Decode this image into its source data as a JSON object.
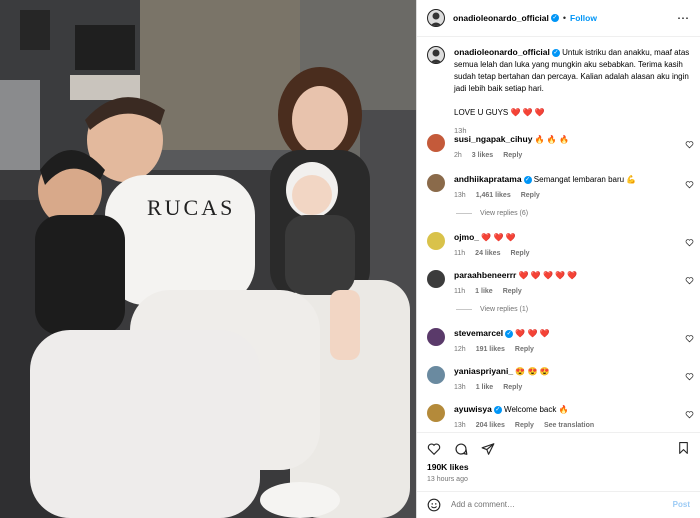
{
  "post": {
    "author": "onadioleonardo_official",
    "follow_label": "Follow",
    "separator": "•",
    "caption": "Untuk istriku dan anakku, maaf atas semua lelah dan luka yang mungkin aku sebabkan. Terima kasih sudah tetap bertahan dan percaya. Kalian adalah alasan aku ingin jadi lebih baik setiap hari.",
    "caption_love": "LOVE U GUYS ❤️ ❤️ ❤️",
    "caption_time": "13h",
    "likes": "190K likes",
    "posted": "13 hours ago",
    "add_comment_placeholder": "Add a comment…",
    "post_button": "Post",
    "photo_shirt_text": "RUCAS"
  },
  "comments": [
    {
      "user": "susi_ngapak_cihuy",
      "verified": false,
      "text": "🔥 🔥 🔥",
      "time": "2h",
      "likes": "3 likes",
      "reply": "Reply"
    },
    {
      "user": "andhiikapratama",
      "verified": true,
      "text": "Semangat lembaran baru 💪",
      "time": "13h",
      "likes": "1,461 likes",
      "reply": "Reply",
      "view_replies": "View replies (6)"
    },
    {
      "user": "ojmo_",
      "verified": false,
      "text": "❤️ ❤️ ❤️",
      "time": "11h",
      "likes": "24 likes",
      "reply": "Reply"
    },
    {
      "user": "paraahbeneerrr",
      "verified": false,
      "text": "❤️ ❤️ ❤️ ❤️ ❤️",
      "time": "11h",
      "likes": "1 like",
      "reply": "Reply",
      "view_replies": "View replies (1)"
    },
    {
      "user": "stevemarcel",
      "verified": true,
      "text": "❤️ ❤️ ❤️",
      "time": "12h",
      "likes": "191 likes",
      "reply": "Reply"
    },
    {
      "user": "yaniaspriyani_",
      "verified": false,
      "text": "😍 😍 😍",
      "time": "13h",
      "likes": "1 like",
      "reply": "Reply"
    },
    {
      "user": "ayuwisya",
      "verified": true,
      "text": "Welcome back 🔥",
      "time": "13h",
      "likes": "204 likes",
      "reply": "Reply",
      "see_translation": "See translation"
    }
  ],
  "colors": {
    "accent": "#0095f6",
    "muted": "#737373",
    "border": "#dbdbdb"
  }
}
